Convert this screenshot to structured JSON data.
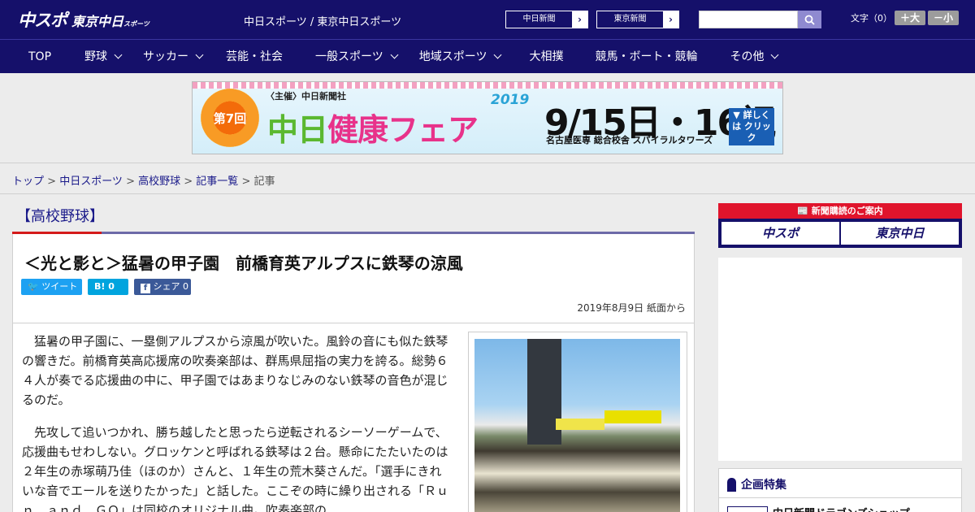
{
  "header": {
    "logo_main": "中スポ",
    "logo_tokyo": "東京中日",
    "logo_tokyo_small": "スポーツ",
    "site_names": "中日スポーツ / 東京中日スポーツ",
    "paper_buttons": [
      "中日新聞",
      "東京新聞"
    ],
    "fontsize_label": "文字（0）",
    "font_larger": "＋大",
    "font_smaller": "－小"
  },
  "nav": {
    "items": [
      {
        "label": "TOP",
        "dropdown": false
      },
      {
        "label": "野球",
        "dropdown": true
      },
      {
        "label": "サッカー",
        "dropdown": true
      },
      {
        "label": "芸能・社会",
        "dropdown": false
      },
      {
        "label": "一般スポーツ",
        "dropdown": true
      },
      {
        "label": "地域スポーツ",
        "dropdown": true
      },
      {
        "label": "大相撲",
        "dropdown": false
      },
      {
        "label": "競馬・ボート・競輪",
        "dropdown": false
      },
      {
        "label": "その他",
        "dropdown": true
      }
    ]
  },
  "banner": {
    "flower_text": "第7回",
    "host": "〈主催〉中日新聞社",
    "title_a": "中日",
    "title_b": "健康フェア",
    "year": "2019",
    "date": "9/15日・16祝",
    "venue": "名古屋医専 総合校舎 スパイラルタワーズ",
    "click": "▼ 詳しくは クリック"
  },
  "breadcrumb": {
    "items": [
      "トップ",
      "中日スポーツ",
      "高校野球",
      "記事一覧"
    ],
    "current": "記事",
    "sep": " > "
  },
  "article": {
    "category": "【高校野球】",
    "headline": "＜光と影と＞猛暑の甲子園　前橋育英アルプスに鉄琴の涼風",
    "share": {
      "tweet": "ツイート",
      "hatena": "B! 0",
      "facebook": "シェア 0"
    },
    "date": "2019年8月9日 紙面から",
    "paragraphs": [
      "　猛暑の甲子園に、一塁側アルプスから涼風が吹いた。風鈴の音にも似た鉄琴の響きだ。前橋育英高応援席の吹奏楽部は、群馬県屈指の実力を誇る。総勢６４人が奏でる応援曲の中に、甲子園ではあまりなじみのない鉄琴の音色が混じるのだ。",
      "　先攻して追いつかれ、勝ち越したと思ったら逆転されるシーソーゲームで、応援曲もせわしない。グロッケンと呼ばれる鉄琴は２台。懸命にたたいたのは２年生の赤塚萌乃佳（ほのか）さんと、１年生の荒木葵さんだ。「選手にきれいな音でエールを送りたかった」と話した。ここぞの時に繰り出される「Ｒｕｎ　ａｎｄ　ＧＯ」は同校のオリジナル曲。吹奏楽部の"
    ]
  },
  "sidebar": {
    "subscribe_head": "新聞購読のご案内",
    "subscribe_buttons": [
      "中スポ",
      "東京中日"
    ],
    "feature_title": "企画特集",
    "feature_item": "中日新聞ドラゴンズショップ"
  },
  "colors": {
    "navy": "#15106a",
    "red": "#d41a1a",
    "twitter": "#1da1f2",
    "hatena": "#00a4de",
    "facebook": "#3b5998"
  }
}
